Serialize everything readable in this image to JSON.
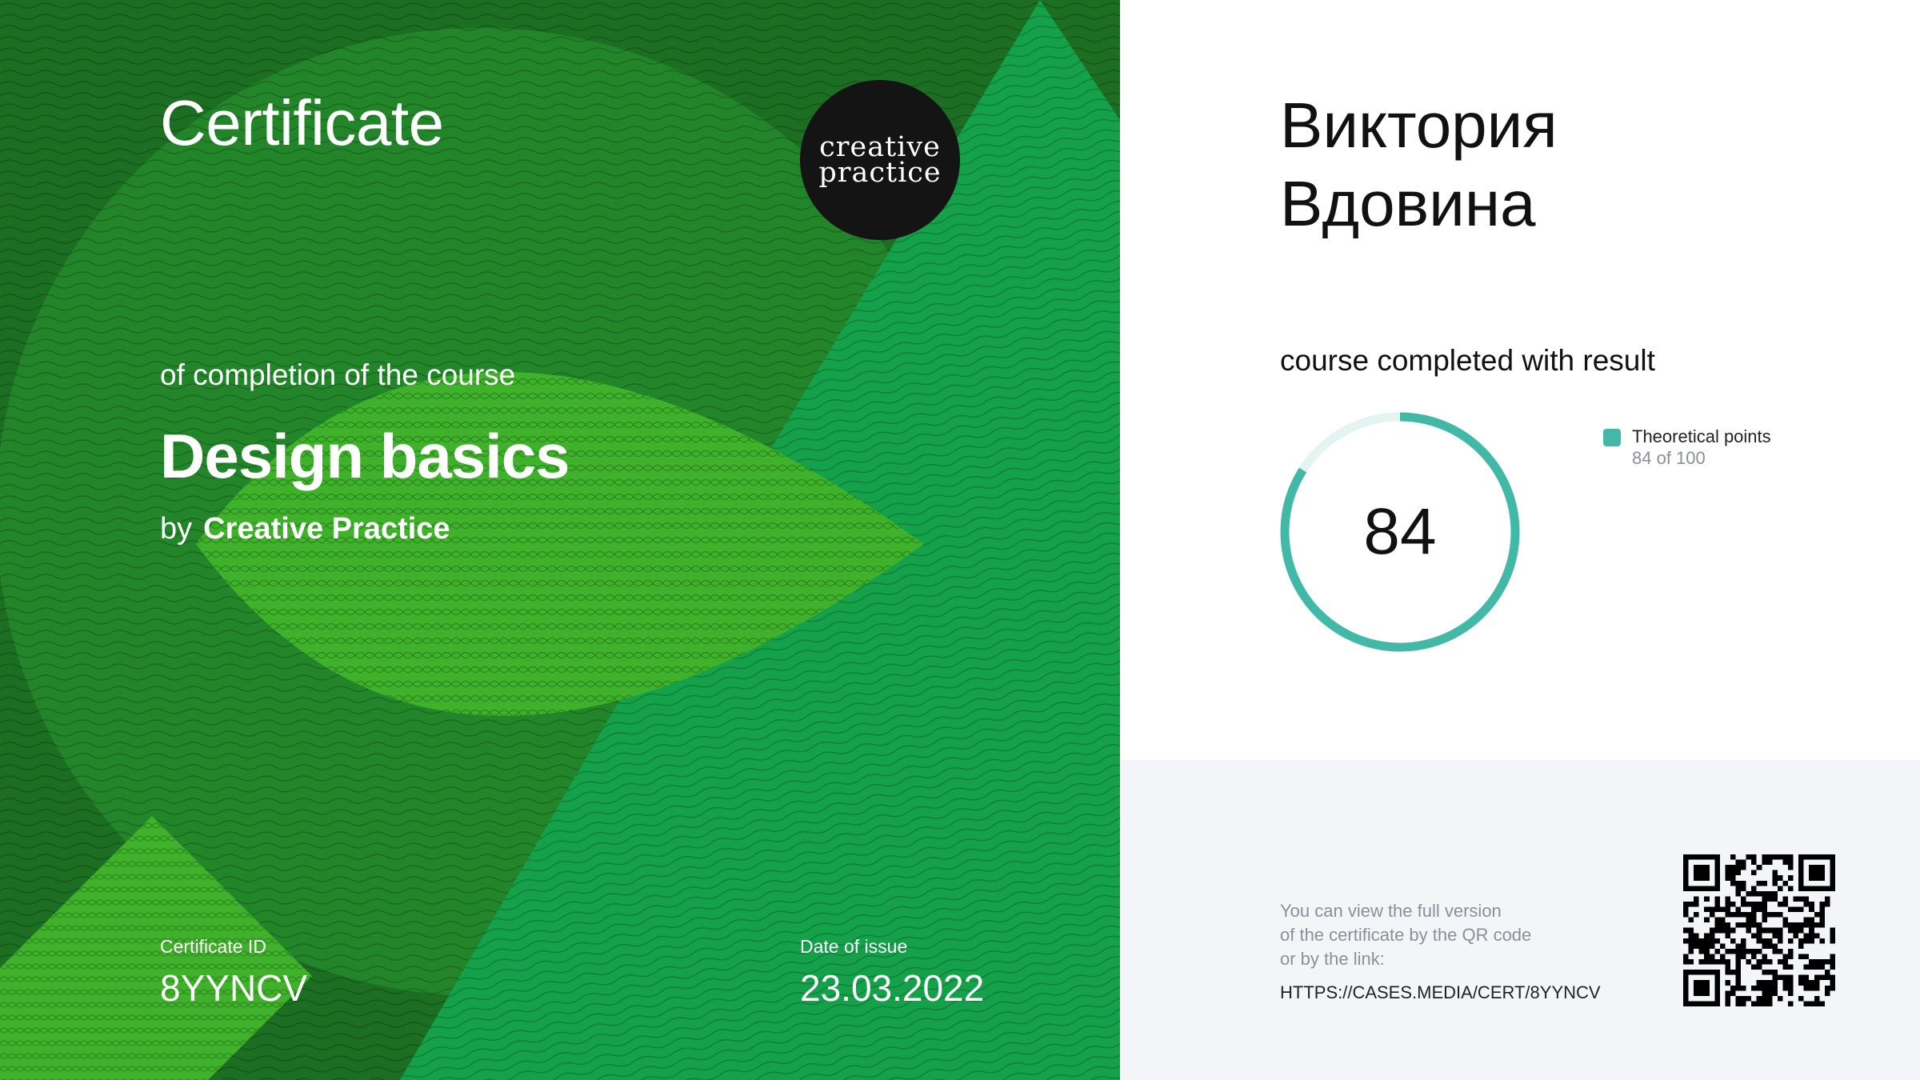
{
  "certificate": {
    "title": "Certificate",
    "subtitle": "of completion of the course",
    "course_name": "Design basics",
    "by_prefix": "by",
    "organization": "Creative Practice",
    "logo_line1": "creative",
    "logo_line2": "practice",
    "id_label": "Certificate ID",
    "id_value": "8YYNCV",
    "date_label": "Date of issue",
    "date_value": "23.03.2022"
  },
  "recipient": {
    "first_name": "Виктория",
    "last_name": "Вдовина"
  },
  "result": {
    "label": "course completed with result",
    "score": "84",
    "score_fraction": 0.84,
    "legend_name": "Theoretical points",
    "legend_detail": "84 of 100",
    "accent_color": "#42b9a7",
    "track_color": "#e3f4f1"
  },
  "verification": {
    "note_line1": "You can view the full version",
    "note_line2": "of the certificate by the QR code",
    "note_line3": "or by the link:",
    "url": "HTTPS://CASES.MEDIA/CERT/8YYNCV"
  },
  "colors": {
    "dark_green": "#1c6e22",
    "mid_green": "#23852a",
    "teal_green": "#14a149",
    "leaf_green": "#3fb12a"
  }
}
